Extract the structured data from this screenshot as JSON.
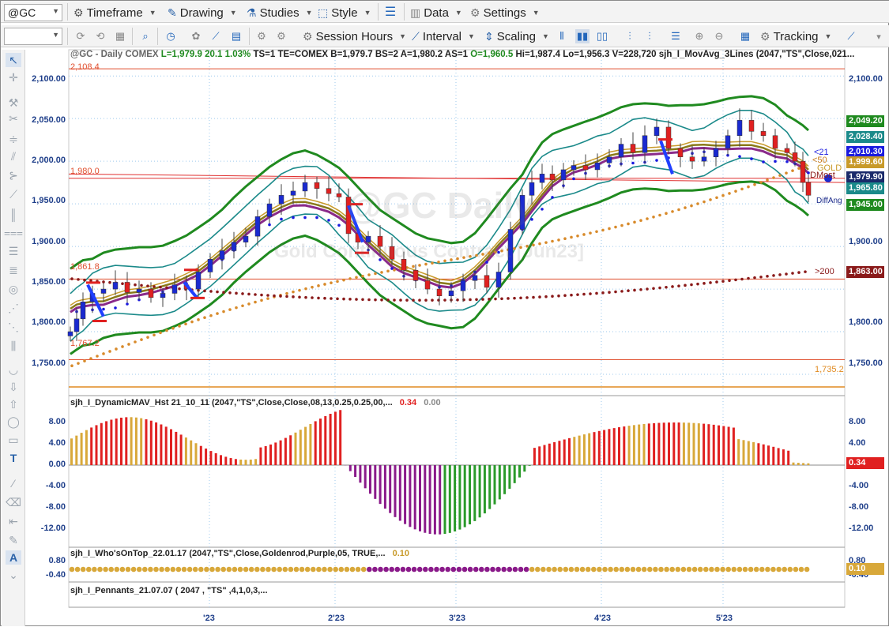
{
  "toolbar": {
    "symbol": "@GC",
    "timeframe": "Timeframe",
    "drawing": "Drawing",
    "studies": "Studies",
    "style": "Style",
    "data": "Data",
    "settings": "Settings",
    "session_hours": "Session Hours",
    "interval": "Interval",
    "scaling": "Scaling",
    "tracking": "Tracking"
  },
  "header": {
    "symbol_desc": "@GC - Daily",
    "exchange": "COMEX",
    "l": "L=1,979.9",
    "chg": "20.1",
    "pct": "1.03%",
    "ts": "TS=1",
    "te": "TE=COMEX",
    "b": "B=1,979.7",
    "bs": "BS=2",
    "a": "A=1,980.2",
    "as": "AS=1",
    "o": "O=1,960.5",
    "hi": "Hi=1,987.4",
    "lo": "Lo=1,956.3",
    "v": "V=228,720",
    "study": "sjh_I_MovAvg_3Lines (2047,\"TS\",Close,021..."
  },
  "watermark": {
    "line1": "@GC Daily",
    "line2": "Gold Continuous Contract [Jun23]"
  },
  "price_axis": [
    "2,100.00",
    "2,050.00",
    "2,000.00",
    "1,950.00",
    "1,900.00",
    "1,850.00",
    "1,800.00",
    "1,750.00"
  ],
  "hlines": {
    "h2108": "2,108.4",
    "h1980": "1,980.0",
    "h1861": "1,861.8",
    "h1767": "1,767.2",
    "h1735": "1,735.2"
  },
  "price_tags": [
    {
      "label": "2,049.20",
      "color": "#1f8a1f"
    },
    {
      "label": "2,028.40",
      "color": "#1b8a8a"
    },
    {
      "label": "2,010.30",
      "color": "#1a1adf"
    },
    {
      "label": "1,999.60",
      "color": "#c89a2a"
    },
    {
      "label": "1,979.90",
      "color": "#1a2a6a"
    },
    {
      "label": "1,965.80",
      "color": "#1b8a8a"
    },
    {
      "label": "1,945.00",
      "color": "#1f8a1f"
    },
    {
      "label": "1,863.00",
      "color": "#8a1a1a"
    }
  ],
  "ma_labels": {
    "l21": "<21",
    "l50": "<50",
    "gold": "GOLD",
    "dmost": "DMost",
    "diffang": "DiffAng",
    "l200": ">200"
  },
  "x_axis": [
    "'23",
    "2'23",
    "3'23",
    "4'23",
    "5'23"
  ],
  "ind1": {
    "title": "sjh_I_DynamicMAV_Hst 21_10_11 (2047,\"TS\",Close,Close,08,13,0.25,0.25,00,...",
    "v1": "0.34",
    "v2": "0.00",
    "axis": [
      "8.00",
      "4.00",
      "0.00",
      "-4.00",
      "-8.00",
      "-12.00"
    ],
    "tag": "0.34"
  },
  "ind2": {
    "title": "sjh_I_Who'sOnTop_22.01.17 (2047,\"TS\",Close,Goldenrod,Purple,05, TRUE,...",
    "v1": "0.10",
    "axis": [
      "0.80",
      "-0.40"
    ],
    "tag": "0.10"
  },
  "ind3": {
    "title": "sjh_I_Pennants_21.07.07 ( 2047 , \"TS\" ,4,1,0,3,..."
  },
  "chart_data": {
    "type": "candlestick",
    "title": "@GC - Daily",
    "ylim": [
      1725,
      2115
    ],
    "y_ticks": [
      1750,
      1800,
      1850,
      1900,
      1950,
      2000,
      2050,
      2100
    ],
    "last_close": 1979.9,
    "histogram": {
      "name": "sjh_I_DynamicMAV_Hst",
      "ylim": [
        -13.5,
        10
      ],
      "last": 0.34
    }
  }
}
